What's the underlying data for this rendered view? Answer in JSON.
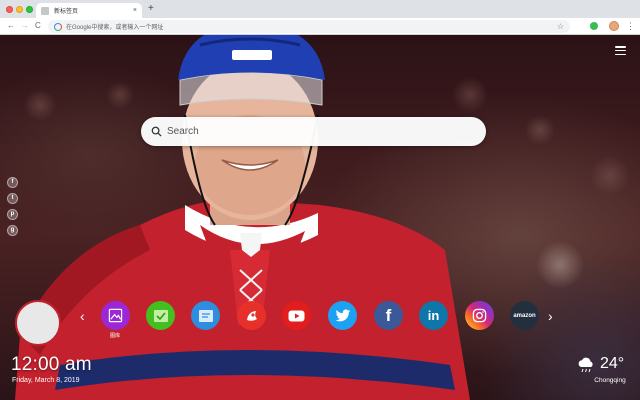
{
  "browser": {
    "tab_title": "新标签页",
    "tab_close": "×",
    "new_tab": "+",
    "omnibox_placeholder": "在Google中搜索，或者输入一个网址",
    "nav": {
      "back": "←",
      "forward": "→",
      "reload": "C"
    },
    "menu": "⋮"
  },
  "search": {
    "placeholder": "Search"
  },
  "social": [
    "f",
    "t",
    "p",
    "g"
  ],
  "apps": [
    {
      "name": "image-app",
      "label": "图库",
      "bg": "#9b27d6",
      "icon": "image-icon"
    },
    {
      "name": "tasks-app",
      "label": "",
      "bg": "#43c020",
      "icon": "check-icon"
    },
    {
      "name": "notes-app",
      "label": "",
      "bg": "#2f8de0",
      "icon": "note-icon"
    },
    {
      "name": "game-app",
      "label": "",
      "bg": "#e8302b",
      "icon": "game-icon"
    },
    {
      "name": "youtube-app",
      "label": "",
      "bg": "#e21d1d",
      "icon": "youtube-icon"
    },
    {
      "name": "twitter-app",
      "label": "",
      "bg": "#1da1f2",
      "icon": "twitter-icon"
    },
    {
      "name": "facebook-app",
      "label": "",
      "bg": "#3b5998",
      "icon": "facebook-icon"
    },
    {
      "name": "linkedin-app",
      "label": "",
      "bg": "#0e76a8",
      "icon": "linkedin-icon"
    },
    {
      "name": "instagram-app",
      "label": "",
      "bg": "#d6249f",
      "icon": "instagram-icon"
    },
    {
      "name": "amazon-app",
      "label": "",
      "bg": "#232f3e",
      "icon": "amazon-icon",
      "text": "amazon"
    }
  ],
  "dock": {
    "prev": "‹",
    "next": "›"
  },
  "clock": {
    "time": "12:00 am",
    "date": "Friday, March 8, 2019"
  },
  "weather": {
    "temp": "24°",
    "city": "Chongqing",
    "icon": "cloud-rain-icon"
  }
}
